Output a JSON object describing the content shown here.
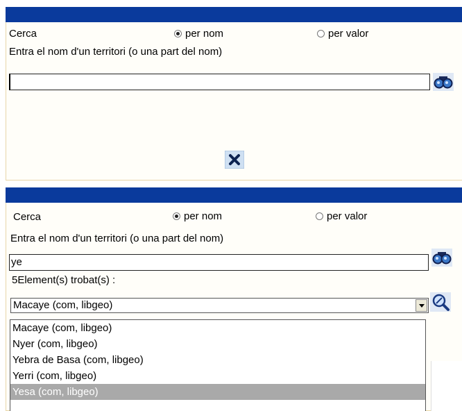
{
  "panel_top": {
    "search_label": "Cerca",
    "radio_name_label": "per nom",
    "radio_value_label": "per valor",
    "radio_name_checked": true,
    "prompt": "Entra el nom d'un territori (o una part del nom)",
    "search_value": "",
    "search_icon": "binoculars-icon",
    "close_icon": "close-icon"
  },
  "panel_bottom": {
    "search_label": "Cerca",
    "radio_name_label": "per nom",
    "radio_value_label": "per valor",
    "radio_name_checked": true,
    "prompt": "Entra el nom d'un territori (o una part del nom)",
    "search_value": "ye",
    "search_icon": "binoculars-icon",
    "results_count_label": "5Element(s) trobat(s) :",
    "selected_result": "Macaye (com, libgeo)",
    "zoom_icon": "zoom-icon",
    "results": [
      "Macaye (com, libgeo)",
      "Nyer (com, libgeo)",
      "Yebra de Basa (com, libgeo)",
      "Yerri (com, libgeo)",
      "Yesa (com, libgeo)"
    ],
    "highlighted_index": 4
  },
  "colors": {
    "titlebar": "#0a3a9c",
    "panel_border": "#e8d6a8",
    "highlight": "#a9a9a9"
  }
}
